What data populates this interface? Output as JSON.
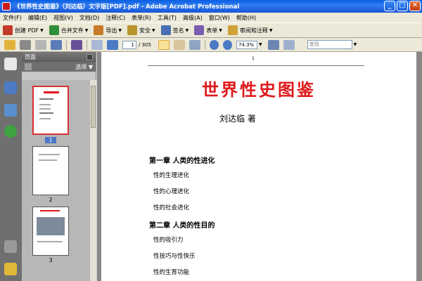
{
  "window": {
    "title": "《世界性史图鉴》（刘达临）文字版[PDF].pdf - Adobe Acrobat Professional",
    "buttons": [
      "_",
      "□",
      "✕"
    ]
  },
  "menu": [
    "文件(F)",
    "编辑(E)",
    "视图(V)",
    "文档(D)",
    "注释(C)",
    "表单(R)",
    "工具(T)",
    "高级(A)",
    "窗口(W)",
    "帮助(H)"
  ],
  "task_toolbar": [
    {
      "label": "创建 PDF",
      "icon": "create-pdf-icon",
      "color": "#c43a2a"
    },
    {
      "label": "合并文件",
      "icon": "combine-files-icon",
      "color": "#2f8f3a"
    },
    {
      "label": "导出",
      "icon": "export-icon",
      "color": "#c77b2a"
    },
    {
      "label": "安全",
      "icon": "lock-icon",
      "color": "#b8942a"
    },
    {
      "label": "签名",
      "icon": "pen-icon",
      "color": "#4a6fb4"
    },
    {
      "label": "表单",
      "icon": "form-icon",
      "color": "#7a5cb0"
    },
    {
      "label": "审阅和注释",
      "icon": "review-icon",
      "color": "#d0a23a"
    }
  ],
  "nav_toolbar": {
    "current_page": "1",
    "total_pages": "/ 305",
    "zoom": "74.3%",
    "search_placeholder": "查找"
  },
  "panel": {
    "title": "页面",
    "options": "选项",
    "thumbnails": [
      "1",
      "2",
      "3"
    ]
  },
  "document": {
    "page_number": "1",
    "title": "世界性史图鉴",
    "author": "刘达临  著",
    "contents": [
      {
        "type": "chapter",
        "text": "第一章  人类的性进化"
      },
      {
        "type": "section",
        "text": "性的生理进化"
      },
      {
        "type": "section",
        "text": "性的心理进化"
      },
      {
        "type": "section",
        "text": "性的社会进化"
      },
      {
        "type": "chapter",
        "text": "第二章  人类的性目的"
      },
      {
        "type": "section",
        "text": "性的吸引力"
      },
      {
        "type": "section",
        "text": "性技巧与性快乐"
      },
      {
        "type": "section",
        "text": "性的生育功能"
      }
    ]
  }
}
